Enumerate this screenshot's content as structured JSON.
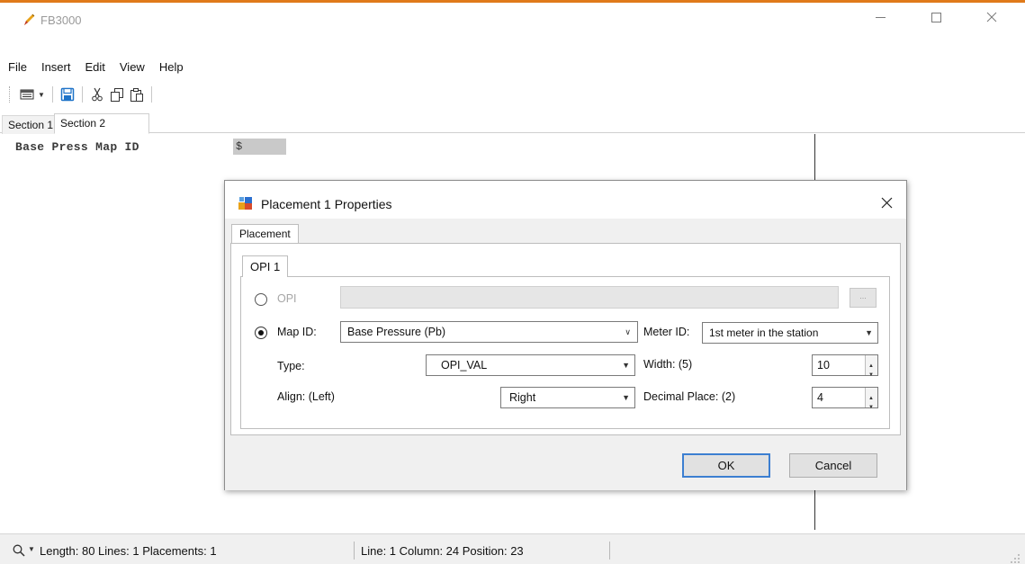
{
  "window": {
    "title": "FB3000",
    "accent_color": "#e07a1a"
  },
  "menu": [
    "File",
    "Insert",
    "Edit",
    "View",
    "Help"
  ],
  "toolbar": {
    "icons": [
      "report-icon",
      "save-icon",
      "cut-icon",
      "copy-icon",
      "paste-icon"
    ]
  },
  "section_tabs": [
    "Section 1",
    "Section 2"
  ],
  "editor": {
    "line_text": "Base Press Map ID",
    "field_marker": "$"
  },
  "dialog": {
    "title": "Placement 1 Properties",
    "outer_tab": "Placement",
    "inner_tab": "OPI 1",
    "opi_label": "OPI",
    "opi_browse": "...",
    "map_id_label": "Map ID:",
    "map_id_value": "Base Pressure (Pb)",
    "meter_id_label": "Meter ID:",
    "meter_id_value": "1st meter in the station",
    "type_label": "Type:",
    "type_value": "OPI_VAL",
    "width_label": "Width: (5)",
    "width_value": "10",
    "align_label": "Align: (Left)",
    "align_value": "Right",
    "decimal_label": "Decimal Place: (2)",
    "decimal_value": "4",
    "ok_label": "OK",
    "cancel_label": "Cancel",
    "selected_option": "Map ID"
  },
  "status": {
    "left": "Length: 80 Lines: 1 Placements: 1",
    "middle": "Line: 1 Column: 24 Position: 23"
  }
}
